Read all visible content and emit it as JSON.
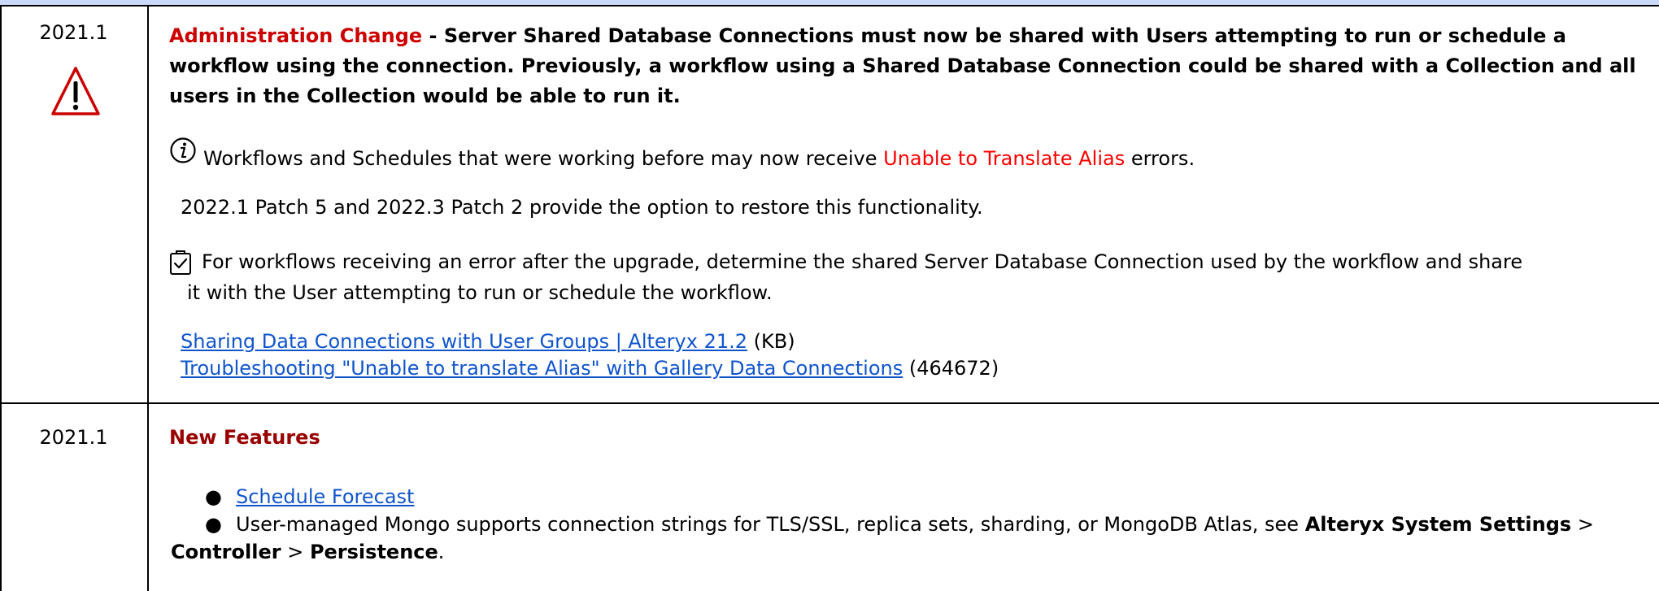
{
  "rows": [
    {
      "version": "2021.1",
      "icon": "warning-triangle-icon",
      "heading_label": "Administration Change",
      "heading_text": " - Server Shared Database Connections must now be shared with Users attempting to run or schedule a workflow using the connection. Previously, a workflow using a Shared Database Connection could be shared with a Collection and all users in the Collection would be able to run it.",
      "info": {
        "icon": "info-circle-icon",
        "text_before": "Workflows and Schedules that were working before may now receive ",
        "highlight": "Unable to Translate Alias",
        "text_after": " errors.",
        "note": "2022.1 Patch 5 and 2022.3 Patch 2 provide the option to restore this functionality."
      },
      "action": {
        "icon": "clipboard-check-icon",
        "line1": "For workflows receiving an error after the upgrade, determine the shared Server Database Connection used by the workflow and share",
        "line2": "it with the User attempting to run or schedule the workflow."
      },
      "links": [
        {
          "text": "Sharing Data Connections with User Groups | Alteryx 21.2",
          "suffix": " (KB)"
        },
        {
          "text": "Troubleshooting \"Unable to translate Alias\" with Gallery Data Connections",
          "suffix": " (464672)"
        }
      ]
    },
    {
      "version": "2021.1",
      "heading": "New Features",
      "bullets": [
        {
          "link": "Schedule Forecast"
        },
        {
          "text1": "User-managed Mongo supports connection strings for TLS/SSL, replica sets, sharding, or MongoDB Atlas, see ",
          "bold1": "Alteryx System Settings",
          "sep1": " >",
          "bold2": "Controller",
          "sep2": " > ",
          "bold3": "Persistence",
          "end": "."
        }
      ]
    }
  ],
  "colors": {
    "header_band": "#c9daf8",
    "admin_label": "#cc0000",
    "new_features": "#990000",
    "alias_highlight": "#ff0000",
    "link": "#1155cc"
  }
}
